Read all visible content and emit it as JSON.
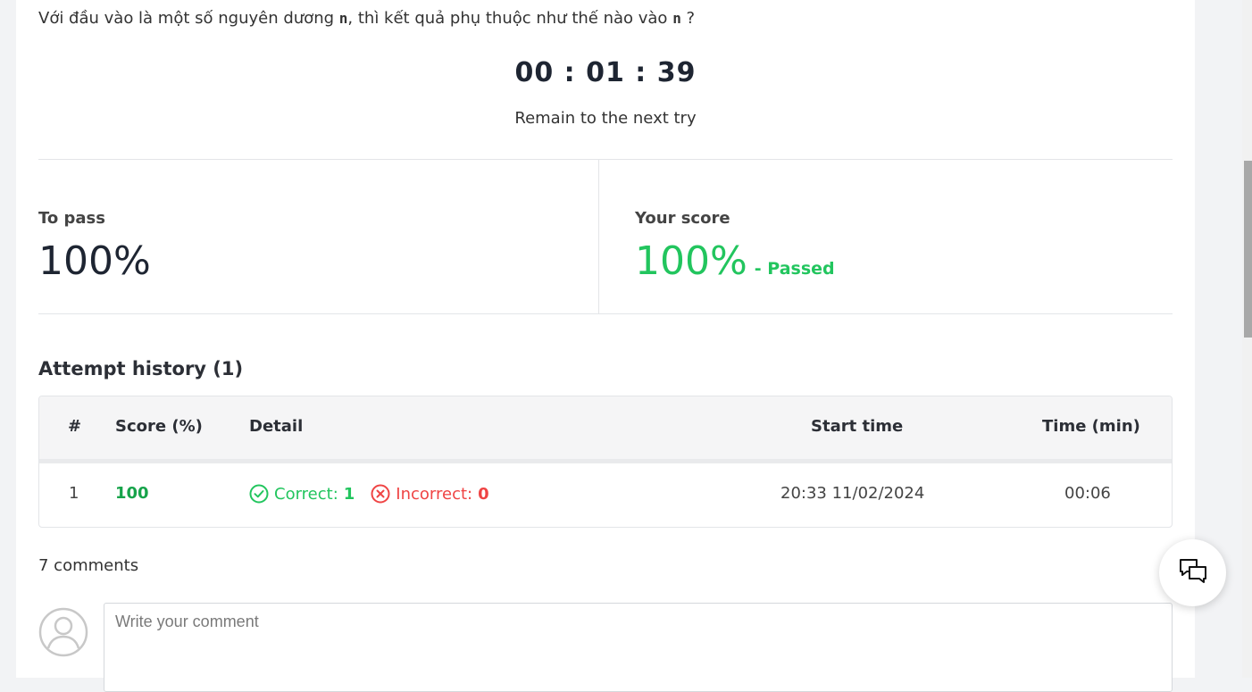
{
  "question": {
    "prefix": "Với đầu vào là một số nguyên dương",
    "var1": "n",
    "middle": ", thì kết quả phụ thuộc như thế nào vào",
    "var2": "n",
    "suffix": " ?"
  },
  "timer": {
    "value": "00 : 01 : 39",
    "label": "Remain to the next try"
  },
  "stats": {
    "to_pass_label": "To pass",
    "to_pass_value": "100%",
    "your_score_label": "Your score",
    "your_score_value": "100%",
    "status": "- Passed"
  },
  "history": {
    "title": "Attempt history (1)",
    "headers": {
      "num": "#",
      "score": "Score (%)",
      "detail": "Detail",
      "start": "Start time",
      "time": "Time (min)"
    },
    "rows": [
      {
        "num": "1",
        "score": "100",
        "correct_label": "Correct:",
        "correct_value": "1",
        "incorrect_label": "Incorrect:",
        "incorrect_value": "0",
        "start": "20:33 11/02/2024",
        "time": "00:06"
      }
    ]
  },
  "comments": {
    "count_text": "7 comments",
    "placeholder": "Write your comment"
  },
  "colors": {
    "passed_green": "#22c55e",
    "score_green": "#16a34a",
    "incorrect_red": "#ef4444"
  },
  "icons": {
    "correct": "check-circle-icon",
    "incorrect": "x-circle-icon",
    "avatar": "user-avatar-icon",
    "chat": "chat-bubbles-icon"
  }
}
